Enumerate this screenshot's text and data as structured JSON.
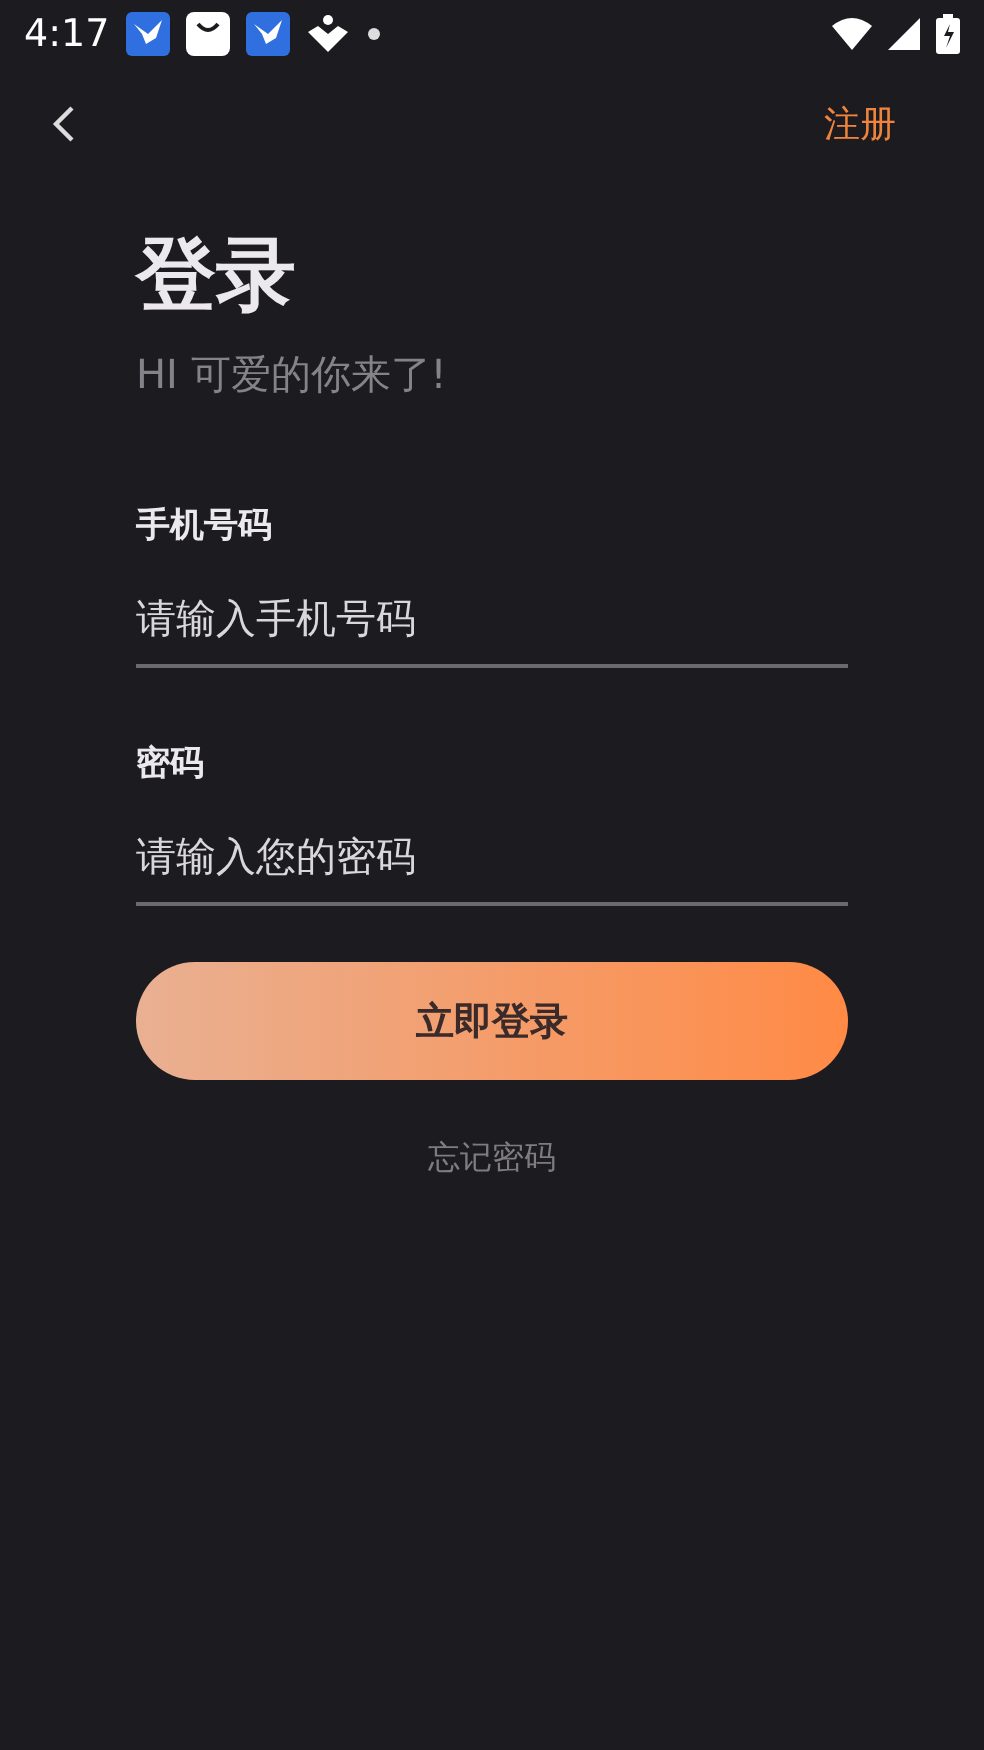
{
  "status_bar": {
    "time": "4:17"
  },
  "nav": {
    "action": "注册"
  },
  "title": "登录",
  "subtitle": "HI 可爱的你来了!",
  "fields": [
    {
      "label": "手机号码",
      "placeholder": "请输入手机号码"
    },
    {
      "label": "密码",
      "placeholder": "请输入您的密码"
    }
  ],
  "submit": "立即登录",
  "forgot": "忘记密码"
}
